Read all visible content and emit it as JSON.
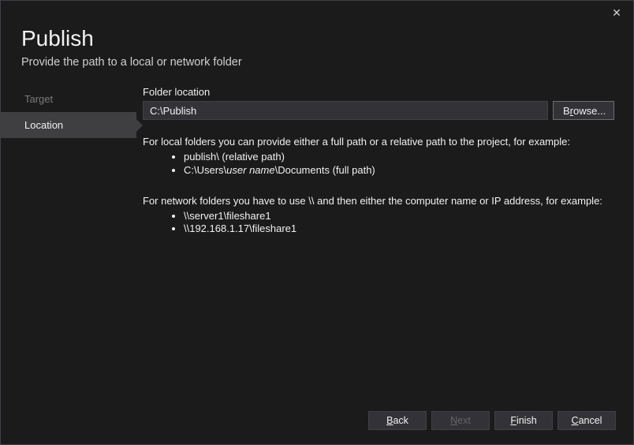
{
  "close_glyph": "✕",
  "header": {
    "title": "Publish",
    "subtitle": "Provide the path to a local or network folder"
  },
  "sidebar": {
    "items": [
      {
        "label": "Target",
        "state": "completed"
      },
      {
        "label": "Location",
        "state": "active"
      }
    ]
  },
  "content": {
    "folder_label": "Folder location",
    "folder_value": "C:\\Publish",
    "browse_pre": "B",
    "browse_accel": "r",
    "browse_post": "owse...",
    "help": {
      "p1": "For local folders you can provide either a full path or a relative path to the project, for example:",
      "li1": "publish\\ (relative path)",
      "li2a": "C:\\Users\\",
      "li2b": "user name",
      "li2c": "\\Documents (full path)",
      "p2": "For network folders you have to use \\\\ and then either the computer name or IP address, for example:",
      "li3": "\\\\server1\\fileshare1",
      "li4": "\\\\192.168.1.17\\fileshare1"
    }
  },
  "footer": {
    "back_accel": "B",
    "back_post": "ack",
    "next_accel": "N",
    "next_post": "ext",
    "finish_accel": "F",
    "finish_post": "inish",
    "cancel_pre": "",
    "cancel_accel": "C",
    "cancel_post": "ancel"
  }
}
